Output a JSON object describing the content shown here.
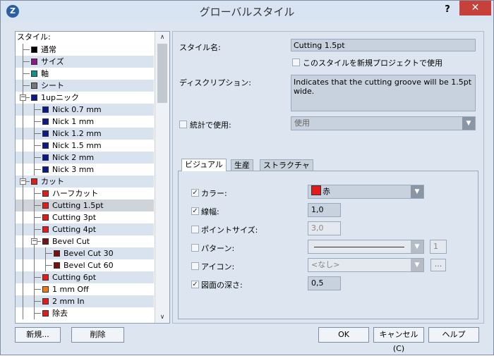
{
  "window": {
    "title": "グローバルスタイル",
    "help": "?",
    "close": "✕",
    "app_icon": "Z"
  },
  "tree": {
    "header": "スタイル:",
    "items": [
      {
        "label": "通常",
        "color": "#000000"
      },
      {
        "label": "サイズ",
        "color": "#8b1a89"
      },
      {
        "label": "軸",
        "color": "#138e8a"
      },
      {
        "label": "シート",
        "color": "#777777"
      },
      {
        "label": "1upニック",
        "color": "#0a1a8c"
      },
      {
        "label": "Nick 0.7 mm",
        "color": "#0a1a8c"
      },
      {
        "label": "Nick 1 mm",
        "color": "#0a1a8c"
      },
      {
        "label": "Nick 1.2 mm",
        "color": "#0a1a8c"
      },
      {
        "label": "Nick 1.5 mm",
        "color": "#0a1a8c"
      },
      {
        "label": "Nick 2 mm",
        "color": "#0a1a8c"
      },
      {
        "label": "Nick 3 mm",
        "color": "#0a1a8c"
      },
      {
        "label": "カット",
        "color": "#e31b1b"
      },
      {
        "label": "ハーフカット",
        "color": "#e31b1b"
      },
      {
        "label": "Cutting 1.5pt",
        "color": "#e31b1b"
      },
      {
        "label": "Cutting 3pt",
        "color": "#e31b1b"
      },
      {
        "label": "Cutting 4pt",
        "color": "#e31b1b"
      },
      {
        "label": "Bevel Cut",
        "color": "#7a1010"
      },
      {
        "label": "Bevel Cut 30",
        "color": "#7a1010"
      },
      {
        "label": "Bevel Cut 60",
        "color": "#7a1010"
      },
      {
        "label": "Cutting 6pt",
        "color": "#e31b1b"
      },
      {
        "label": "1 mm Off",
        "color": "#f07a10"
      },
      {
        "label": "2 mm In",
        "color": "#e31b1b"
      },
      {
        "label": "除去",
        "color": "#e31b1b"
      }
    ],
    "selected_index": 13,
    "scroll_up": "∧",
    "scroll_down": "∨"
  },
  "details": {
    "style_name_label": "スタイル名:",
    "style_name_value": "Cutting 1.5pt",
    "new_project_use": "このスタイルを新規プロジェクトで使用",
    "description_label": "ディスクリプション:",
    "description_value": "Indicates that the cutting groove will be 1.5pt wide.",
    "stats_use_label": "統計で使用:",
    "stats_use_value": "使用",
    "tabs": [
      "ビジュアル",
      "生産",
      "ストラクチャ"
    ],
    "visual": {
      "color_label": "カラー:",
      "color_value": "赤",
      "color_swatch": "#e31b1b",
      "line_width_label": "線幅:",
      "line_width_value": "1,0",
      "point_size_label": "ポイントサイズ:",
      "point_size_value": "3,0",
      "pattern_label": "パターン:",
      "pattern_value": "1",
      "icon_label": "アイコン:",
      "icon_value": "<なし>",
      "icon_btn": "...",
      "depth_label": "図面の深さ:",
      "depth_value": "0,5"
    }
  },
  "buttons": {
    "new": "新規...",
    "delete": "削除",
    "ok": "OK",
    "cancel": "キャンセル(C)",
    "help": "ヘルプ"
  }
}
